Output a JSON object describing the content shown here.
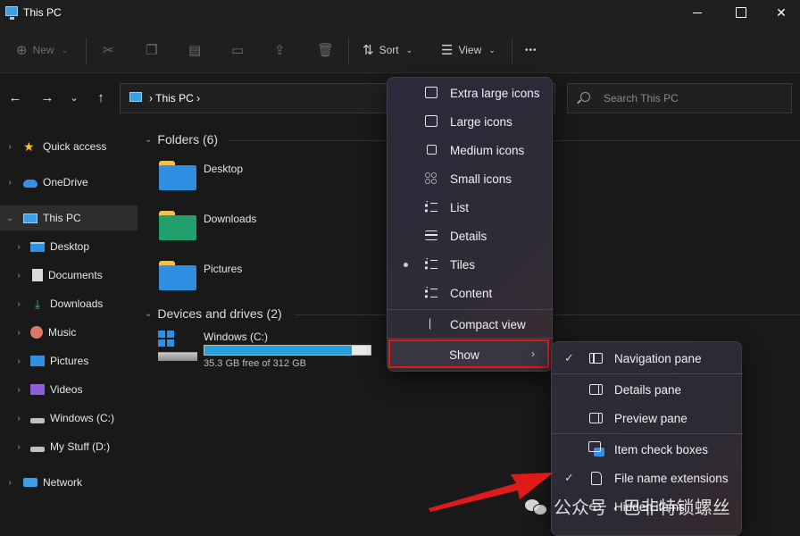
{
  "window": {
    "title": "This PC"
  },
  "toolbar": {
    "new_label": "New",
    "sort_label": "Sort",
    "view_label": "View",
    "more_glyph": "•••"
  },
  "address": {
    "location": "This PC",
    "search_placeholder": "Search This PC"
  },
  "sidebar": {
    "items": [
      {
        "label": "Quick access",
        "icon": "star-icon"
      },
      {
        "label": "OneDrive",
        "icon": "cloud-icon"
      },
      {
        "label": "This PC",
        "icon": "pc-icon"
      },
      {
        "label": "Desktop",
        "icon": "desktop-icon"
      },
      {
        "label": "Documents",
        "icon": "documents-icon"
      },
      {
        "label": "Downloads",
        "icon": "download-icon"
      },
      {
        "label": "Music",
        "icon": "music-icon"
      },
      {
        "label": "Pictures",
        "icon": "pictures-icon"
      },
      {
        "label": "Videos",
        "icon": "videos-icon"
      },
      {
        "label": "Windows (C:)",
        "icon": "drive-icon"
      },
      {
        "label": "My Stuff (D:)",
        "icon": "drive-icon"
      },
      {
        "label": "Network",
        "icon": "network-icon"
      }
    ]
  },
  "content": {
    "folders_heading": "Folders (6)",
    "folders": [
      {
        "label": "Desktop",
        "color": "#2f8fe0"
      },
      {
        "label": "Downloads",
        "color": "#22a06b"
      },
      {
        "label": "Pictures",
        "color": "#2f8fe0"
      }
    ],
    "drives_heading": "Devices and drives (2)",
    "drive": {
      "label": "Windows (C:)",
      "free_text": "35.3 GB free of 312 GB",
      "used_fraction": 0.887
    }
  },
  "view_menu": {
    "items": [
      {
        "label": "Extra large icons",
        "icon": "extra-large-icons-icon"
      },
      {
        "label": "Large icons",
        "icon": "large-icons-icon"
      },
      {
        "label": "Medium icons",
        "icon": "medium-icons-icon"
      },
      {
        "label": "Small icons",
        "icon": "small-icons-icon"
      },
      {
        "label": "List",
        "icon": "list-icon"
      },
      {
        "label": "Details",
        "icon": "details-icon"
      },
      {
        "label": "Tiles",
        "icon": "tiles-icon",
        "selected": true
      },
      {
        "label": "Content",
        "icon": "content-icon"
      }
    ],
    "compact_label": "Compact view",
    "show_label": "Show"
  },
  "show_menu": {
    "items": [
      {
        "label": "Navigation pane",
        "checked": true
      },
      {
        "label": "Details pane",
        "checked": false
      },
      {
        "label": "Preview pane",
        "checked": false
      },
      {
        "label": "Item check boxes",
        "checked": false
      },
      {
        "label": "File name extensions",
        "checked": true
      },
      {
        "label": "Hidden items",
        "checked": false
      }
    ]
  },
  "watermark": {
    "text": "公众号 · 巴非特锁螺丝"
  },
  "colors": {
    "accent": "#26a0da",
    "highlight_border": "#e01a1a",
    "arrow": "#e01a1a"
  }
}
